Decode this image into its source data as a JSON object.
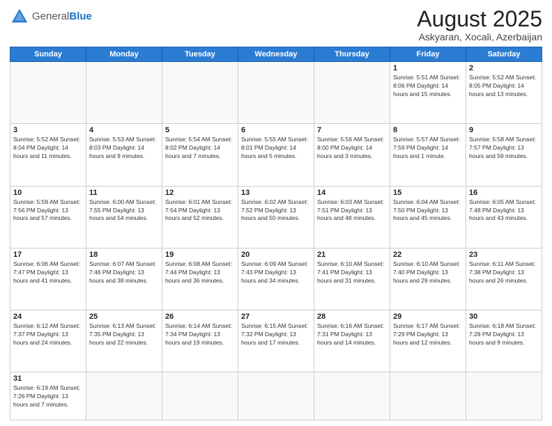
{
  "logo": {
    "general": "General",
    "blue": "Blue"
  },
  "header": {
    "month_year": "August 2025",
    "location": "Askyaran, Xocali, Azerbaijan"
  },
  "weekdays": [
    "Sunday",
    "Monday",
    "Tuesday",
    "Wednesday",
    "Thursday",
    "Friday",
    "Saturday"
  ],
  "weeks": [
    [
      {
        "day": "",
        "info": ""
      },
      {
        "day": "",
        "info": ""
      },
      {
        "day": "",
        "info": ""
      },
      {
        "day": "",
        "info": ""
      },
      {
        "day": "",
        "info": ""
      },
      {
        "day": "1",
        "info": "Sunrise: 5:51 AM\nSunset: 8:06 PM\nDaylight: 14 hours\nand 15 minutes."
      },
      {
        "day": "2",
        "info": "Sunrise: 5:52 AM\nSunset: 8:05 PM\nDaylight: 14 hours\nand 13 minutes."
      }
    ],
    [
      {
        "day": "3",
        "info": "Sunrise: 5:52 AM\nSunset: 8:04 PM\nDaylight: 14 hours\nand 11 minutes."
      },
      {
        "day": "4",
        "info": "Sunrise: 5:53 AM\nSunset: 8:03 PM\nDaylight: 14 hours\nand 9 minutes."
      },
      {
        "day": "5",
        "info": "Sunrise: 5:54 AM\nSunset: 8:02 PM\nDaylight: 14 hours\nand 7 minutes."
      },
      {
        "day": "6",
        "info": "Sunrise: 5:55 AM\nSunset: 8:01 PM\nDaylight: 14 hours\nand 5 minutes."
      },
      {
        "day": "7",
        "info": "Sunrise: 5:56 AM\nSunset: 8:00 PM\nDaylight: 14 hours\nand 3 minutes."
      },
      {
        "day": "8",
        "info": "Sunrise: 5:57 AM\nSunset: 7:59 PM\nDaylight: 14 hours\nand 1 minute."
      },
      {
        "day": "9",
        "info": "Sunrise: 5:58 AM\nSunset: 7:57 PM\nDaylight: 13 hours\nand 59 minutes."
      }
    ],
    [
      {
        "day": "10",
        "info": "Sunrise: 5:59 AM\nSunset: 7:56 PM\nDaylight: 13 hours\nand 57 minutes."
      },
      {
        "day": "11",
        "info": "Sunrise: 6:00 AM\nSunset: 7:55 PM\nDaylight: 13 hours\nand 54 minutes."
      },
      {
        "day": "12",
        "info": "Sunrise: 6:01 AM\nSunset: 7:54 PM\nDaylight: 13 hours\nand 52 minutes."
      },
      {
        "day": "13",
        "info": "Sunrise: 6:02 AM\nSunset: 7:52 PM\nDaylight: 13 hours\nand 50 minutes."
      },
      {
        "day": "14",
        "info": "Sunrise: 6:03 AM\nSunset: 7:51 PM\nDaylight: 13 hours\nand 48 minutes."
      },
      {
        "day": "15",
        "info": "Sunrise: 6:04 AM\nSunset: 7:50 PM\nDaylight: 13 hours\nand 45 minutes."
      },
      {
        "day": "16",
        "info": "Sunrise: 6:05 AM\nSunset: 7:48 PM\nDaylight: 13 hours\nand 43 minutes."
      }
    ],
    [
      {
        "day": "17",
        "info": "Sunrise: 6:06 AM\nSunset: 7:47 PM\nDaylight: 13 hours\nand 41 minutes."
      },
      {
        "day": "18",
        "info": "Sunrise: 6:07 AM\nSunset: 7:46 PM\nDaylight: 13 hours\nand 38 minutes."
      },
      {
        "day": "19",
        "info": "Sunrise: 6:08 AM\nSunset: 7:44 PM\nDaylight: 13 hours\nand 36 minutes."
      },
      {
        "day": "20",
        "info": "Sunrise: 6:09 AM\nSunset: 7:43 PM\nDaylight: 13 hours\nand 34 minutes."
      },
      {
        "day": "21",
        "info": "Sunrise: 6:10 AM\nSunset: 7:41 PM\nDaylight: 13 hours\nand 31 minutes."
      },
      {
        "day": "22",
        "info": "Sunrise: 6:10 AM\nSunset: 7:40 PM\nDaylight: 13 hours\nand 29 minutes."
      },
      {
        "day": "23",
        "info": "Sunrise: 6:11 AM\nSunset: 7:38 PM\nDaylight: 13 hours\nand 26 minutes."
      }
    ],
    [
      {
        "day": "24",
        "info": "Sunrise: 6:12 AM\nSunset: 7:37 PM\nDaylight: 13 hours\nand 24 minutes."
      },
      {
        "day": "25",
        "info": "Sunrise: 6:13 AM\nSunset: 7:35 PM\nDaylight: 13 hours\nand 22 minutes."
      },
      {
        "day": "26",
        "info": "Sunrise: 6:14 AM\nSunset: 7:34 PM\nDaylight: 13 hours\nand 19 minutes."
      },
      {
        "day": "27",
        "info": "Sunrise: 6:15 AM\nSunset: 7:32 PM\nDaylight: 13 hours\nand 17 minutes."
      },
      {
        "day": "28",
        "info": "Sunrise: 6:16 AM\nSunset: 7:31 PM\nDaylight: 13 hours\nand 14 minutes."
      },
      {
        "day": "29",
        "info": "Sunrise: 6:17 AM\nSunset: 7:29 PM\nDaylight: 13 hours\nand 12 minutes."
      },
      {
        "day": "30",
        "info": "Sunrise: 6:18 AM\nSunset: 7:28 PM\nDaylight: 13 hours\nand 9 minutes."
      }
    ],
    [
      {
        "day": "31",
        "info": "Sunrise: 6:19 AM\nSunset: 7:26 PM\nDaylight: 13 hours\nand 7 minutes."
      },
      {
        "day": "",
        "info": ""
      },
      {
        "day": "",
        "info": ""
      },
      {
        "day": "",
        "info": ""
      },
      {
        "day": "",
        "info": ""
      },
      {
        "day": "",
        "info": ""
      },
      {
        "day": "",
        "info": ""
      }
    ]
  ]
}
